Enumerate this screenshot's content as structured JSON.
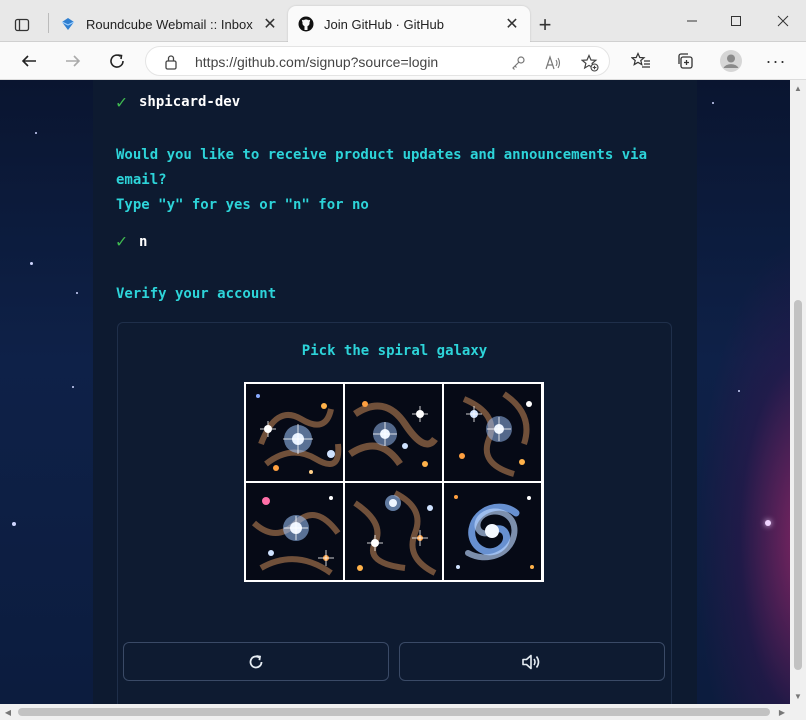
{
  "browser": {
    "tabs": [
      {
        "title": "Roundcube Webmail :: Inbox",
        "icon": "roundcube-icon",
        "active": false
      },
      {
        "title": "Join GitHub · GitHub",
        "icon": "github-icon",
        "active": true
      }
    ],
    "url": "https://github.com/signup?source=login",
    "colors": {
      "tab_strip": "#e8e8e8",
      "toolbar": "#fafafa"
    }
  },
  "signup": {
    "username_answer": "shpicard-dev",
    "updates_question_line1": "Would you like to receive product updates and announcements via",
    "updates_question_line2": "email?",
    "updates_instructions": "Type \"y\" for yes or \"n\" for no",
    "updates_answer": "n",
    "verify_heading": "Verify your account"
  },
  "captcha": {
    "prompt": "Pick the spiral galaxy",
    "tiles": [
      "galaxy-cluster-icon",
      "galaxy-cluster-icon",
      "galaxy-cluster-icon",
      "galaxy-cluster-icon",
      "galaxy-cluster-icon",
      "spiral-galaxy-icon"
    ],
    "buttons": [
      "refresh-icon",
      "audio-icon"
    ]
  },
  "colors": {
    "accent": "#2dd4d9",
    "check": "#3fb950",
    "panel": "#0d1a30",
    "background": "#0b1a33"
  }
}
